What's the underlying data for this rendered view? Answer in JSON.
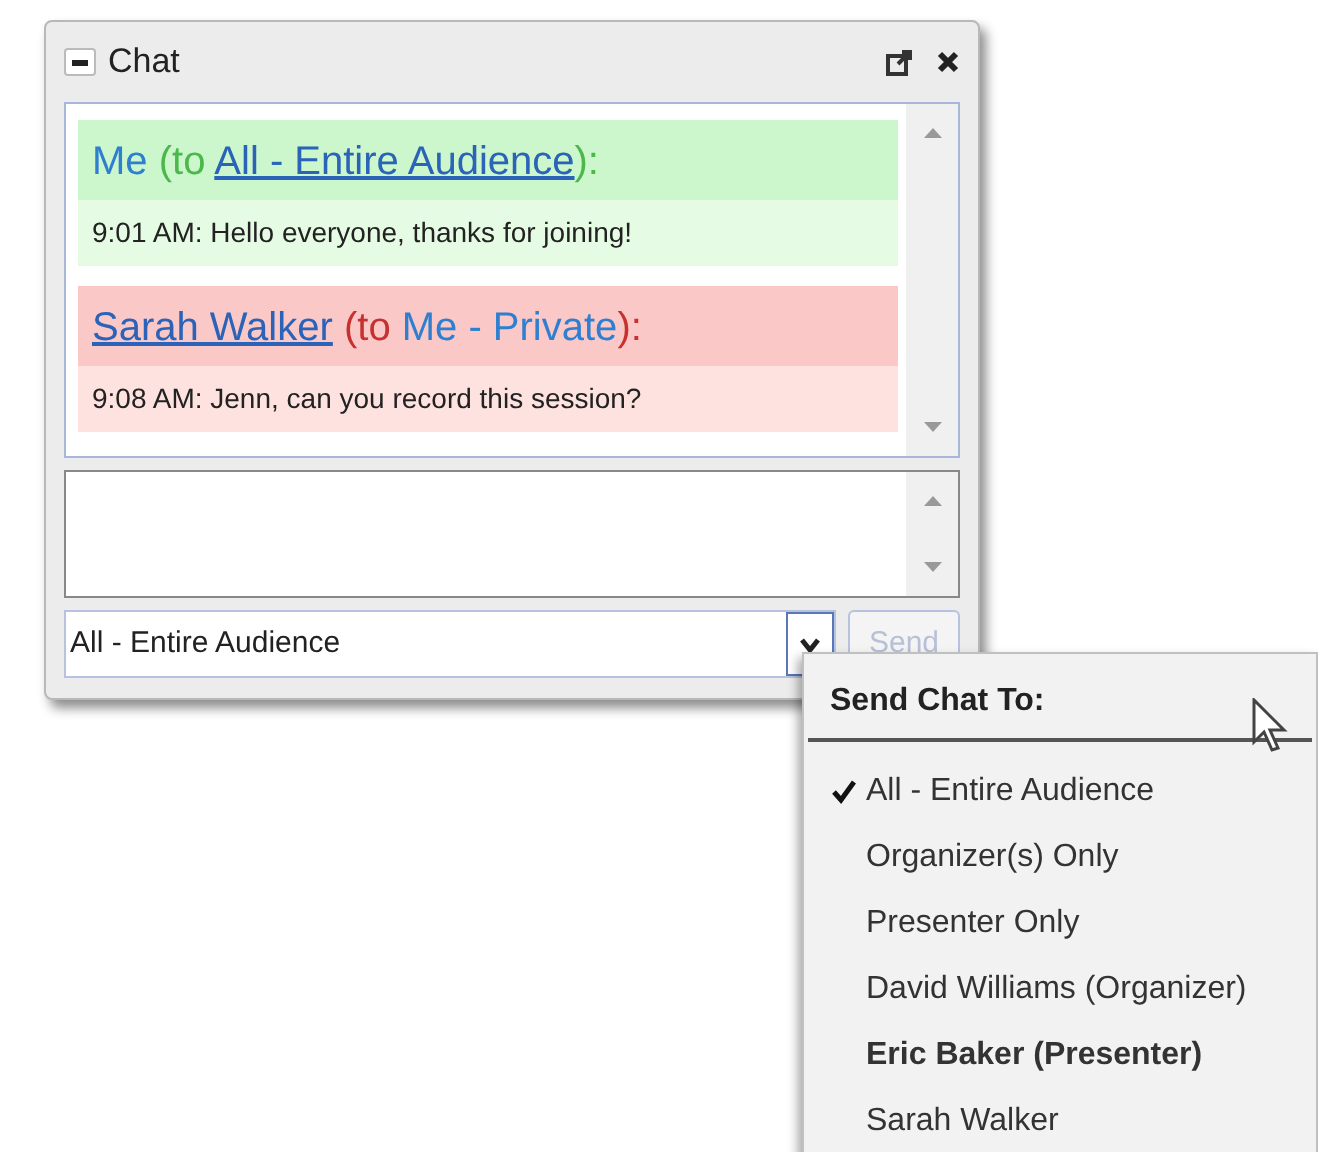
{
  "window": {
    "title": "Chat"
  },
  "messages": [
    {
      "kind": "public",
      "sender": "Me",
      "sender_link": false,
      "prefix": "(to",
      "recipient": "All - Entire Audience",
      "recipient_link": true,
      "suffix": "):",
      "body": "9:01 AM: Hello everyone, thanks for joining!"
    },
    {
      "kind": "private",
      "sender": "Sarah Walker",
      "sender_link": true,
      "prefix": "(to",
      "recipient": "Me - Private",
      "recipient_link": false,
      "suffix": "):",
      "body": "9:08 AM: Jenn, can you record this session?"
    }
  ],
  "recipient_select": {
    "value": "All - Entire Audience"
  },
  "send_button": {
    "label": "Send",
    "disabled": true
  },
  "menu": {
    "title": "Send Chat To:",
    "items": [
      {
        "label": "All - Entire Audience",
        "selected": true,
        "bold": false
      },
      {
        "label": "Organizer(s) Only",
        "selected": false,
        "bold": false
      },
      {
        "label": "Presenter Only",
        "selected": false,
        "bold": false
      },
      {
        "label": "David Williams (Organizer)",
        "selected": false,
        "bold": false
      },
      {
        "label": "Eric Baker (Presenter)",
        "selected": false,
        "bold": true
      },
      {
        "label": "Sarah Walker",
        "selected": false,
        "bold": false
      }
    ]
  }
}
